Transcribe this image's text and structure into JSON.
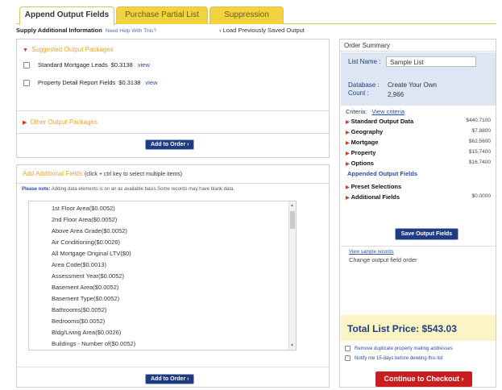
{
  "tabs": [
    {
      "label": "Append Output Fields",
      "active": true
    },
    {
      "label": "Purchase Partial List",
      "active": false
    },
    {
      "label": "Suppression",
      "active": false
    }
  ],
  "subbar": {
    "supply_label": "Supply Additional Information",
    "help_link": "Need Help With This?",
    "load_link": "› Load Previously Saved Output"
  },
  "suggested": {
    "title": "Suggested Output Packages",
    "items": [
      {
        "name": "Standard Mortgage Leads",
        "price": "$0.3138",
        "view": "view"
      },
      {
        "name": "Property Detail Report Fields",
        "price": "$0.3138",
        "view": "view"
      }
    ]
  },
  "other": {
    "title": "Other Output Packages"
  },
  "add_button": "Add to Order ›",
  "additional": {
    "title": "Add Additional Fields",
    "hint": "(click + ctrl key to select multiple items)",
    "note_label": "Please note:",
    "note_text": "Adding data elements is on an as available basis.Some records may have blank data.",
    "fields": [
      "1st Floor Area($0.0052)",
      "2nd Floor Area($0.0052)",
      "Above Area Grade($0.0052)",
      "Air Conditioning($0.0026)",
      "All Mortgage Original LTV($0)",
      "Area Code($0.0013)",
      "Assessment Year($0.0052)",
      "Basement Area($0.0052)",
      "Basement Type($0.0052)",
      "Bathrooms($0.0052)",
      "Bedrooms($0.0052)",
      "Bldg/Living Area($0.0026)",
      "Buildings - Number of($0.0052)"
    ]
  },
  "summary": {
    "header": "Order Summary",
    "list_name_label": "List Name :",
    "list_name_value": "Sample List",
    "database_label": "Database :",
    "database_value": "Create Your Own",
    "count_label": "Count :",
    "count_value": "2,966",
    "criteria_label": "Criteria:",
    "view_criteria": "View criteria",
    "rows": [
      {
        "label": "Standard Output Data",
        "value": "$440.7100"
      },
      {
        "label": "Geography",
        "value": "$7.8800"
      },
      {
        "label": "Mortgage",
        "value": "$62.5600"
      },
      {
        "label": "Property",
        "value": "$15.7400"
      },
      {
        "label": "Options",
        "value": "$16.7400"
      }
    ],
    "appended_title": "Appended Output Fields",
    "preset_label": "Preset Selections",
    "additional_label": "Additional Fields",
    "additional_value": "$0.0000",
    "save_button": "Save Output Fields",
    "view_sample": "View sample records",
    "change_order": "Change output field order",
    "total_label": "Total List Price:",
    "total_value": "$543.03",
    "opt1": "Remove duplicate property mailing addresses",
    "opt2": "Notify me 15-days before deleting this list",
    "checkout_button": "Continue to Checkout ›"
  },
  "colors": {
    "accent_yellow": "#f2d33f",
    "navy": "#1f3c82",
    "red": "#c81e1e",
    "orange": "#e8a23a"
  }
}
